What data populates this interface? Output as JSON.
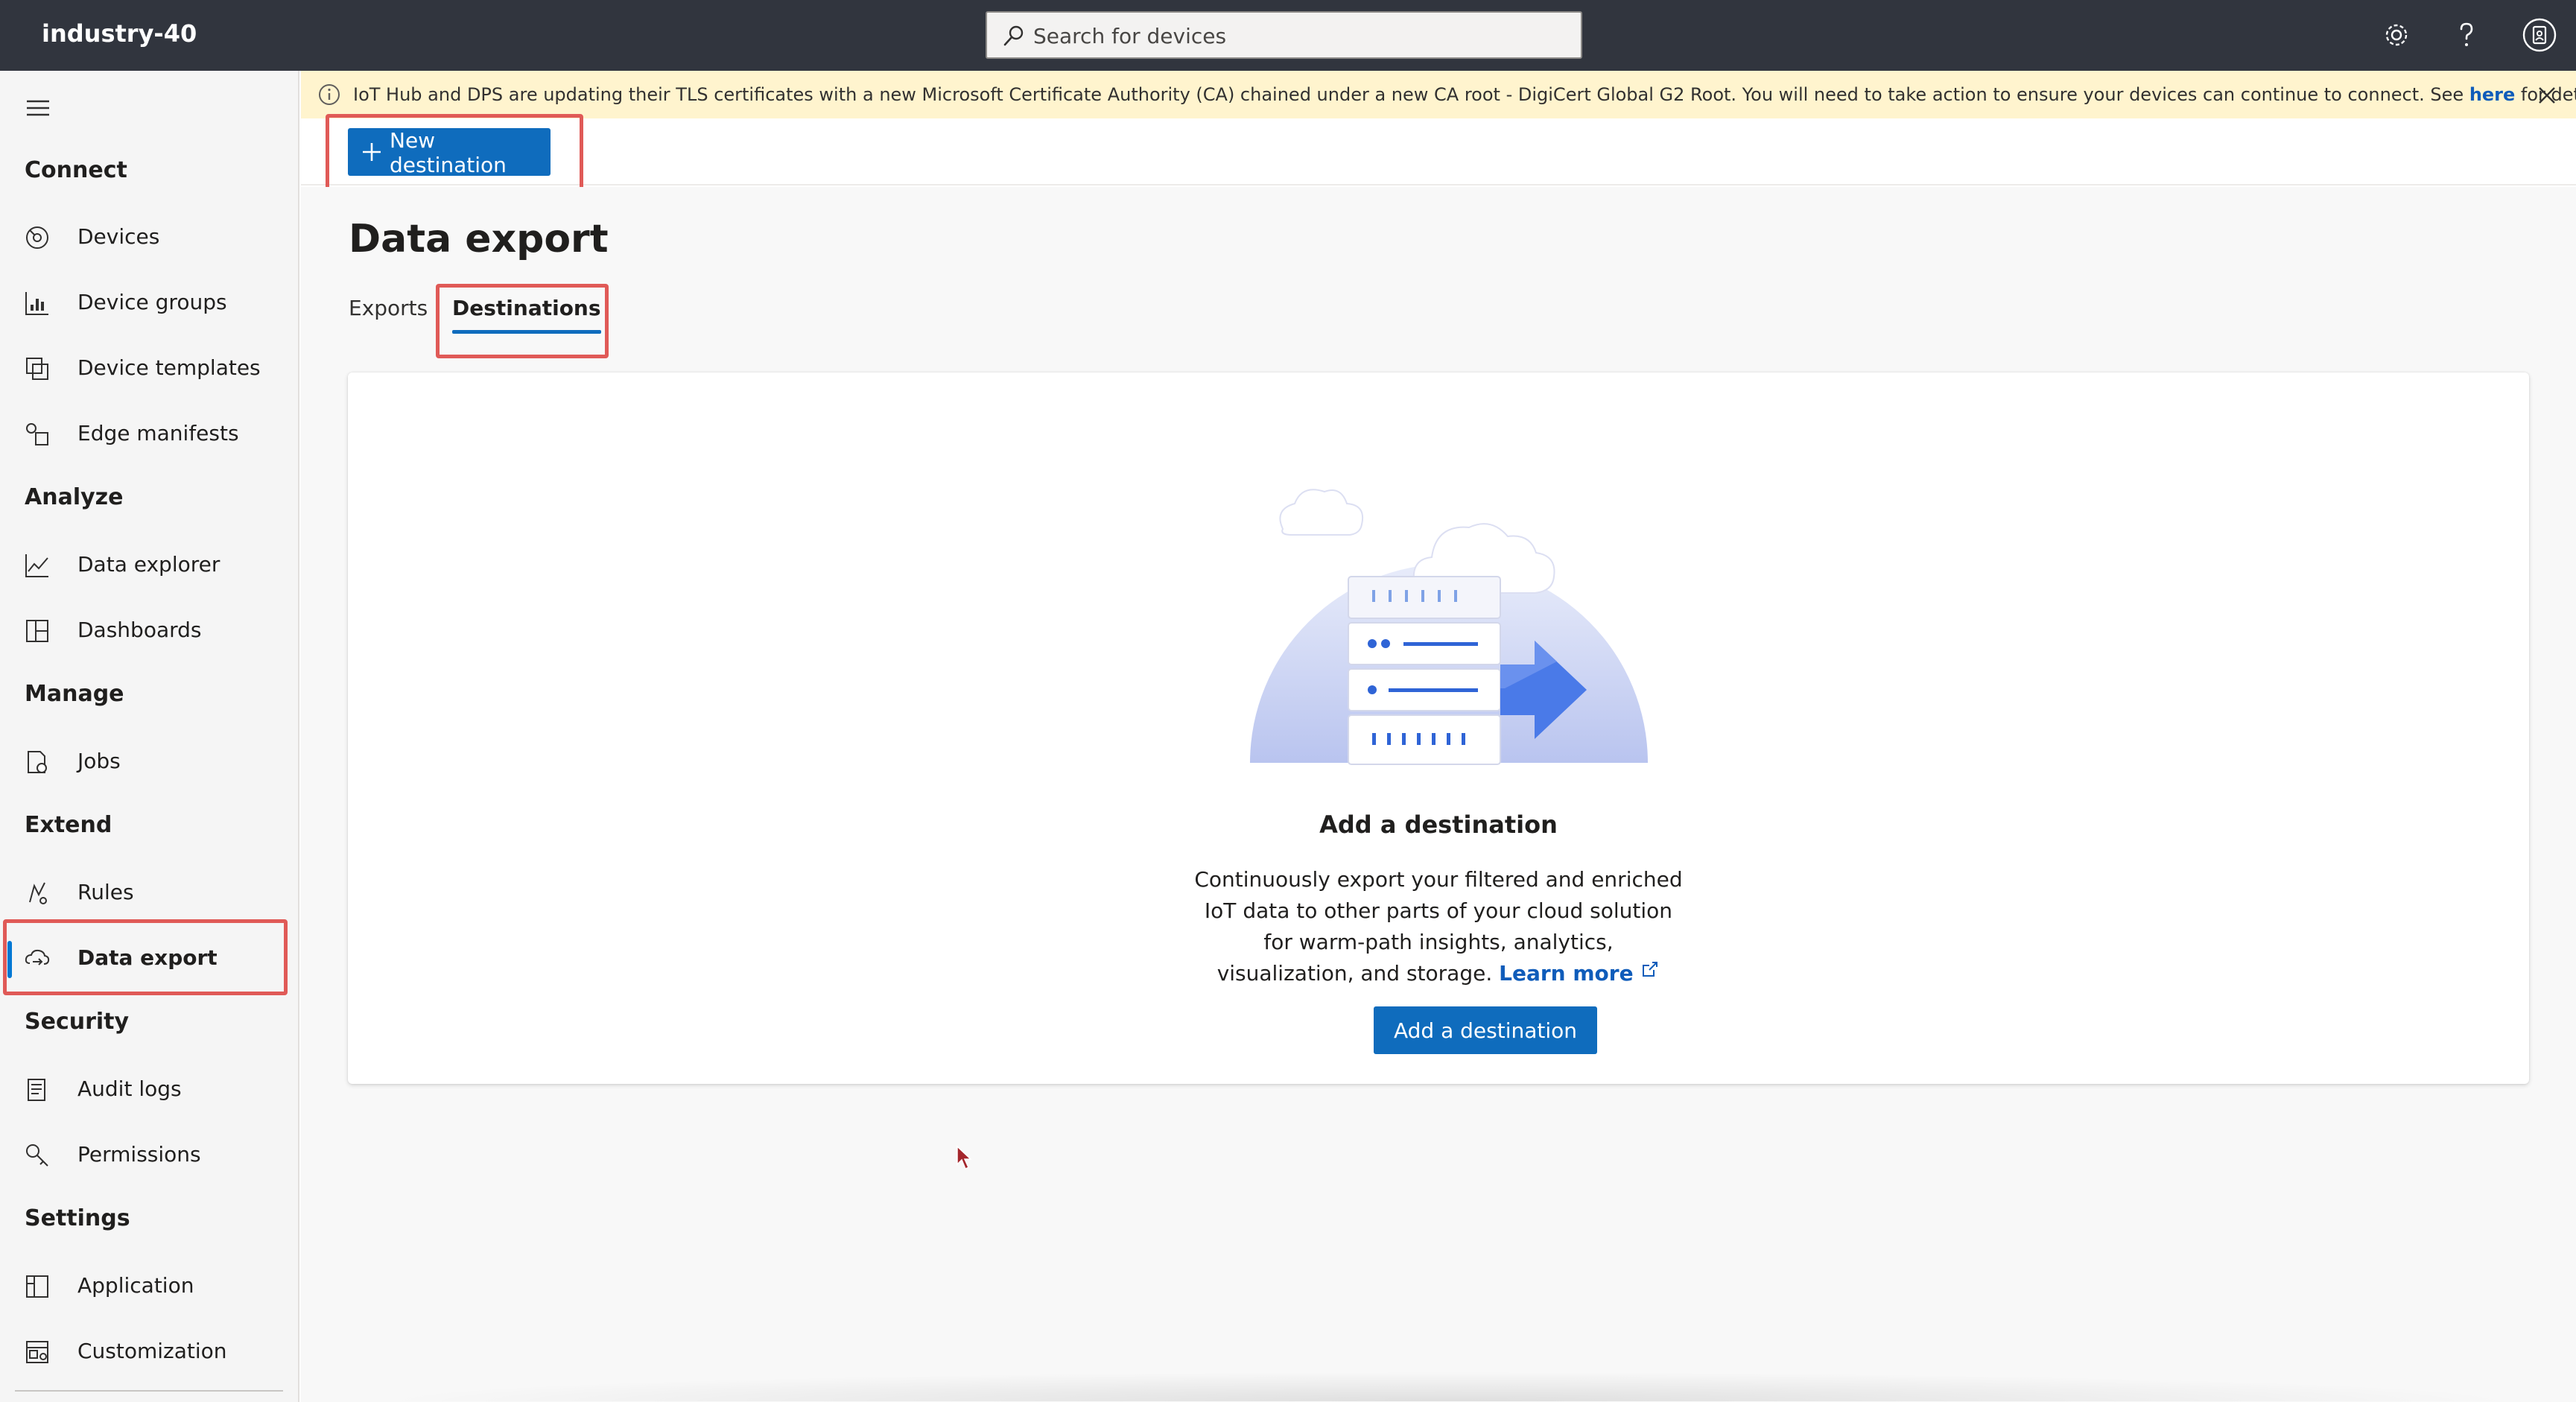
{
  "app": {
    "name": "industry-40"
  },
  "search": {
    "placeholder": "Search for devices"
  },
  "topbar": {
    "icons": [
      "gear-icon",
      "help-icon",
      "account-icon"
    ]
  },
  "sidebar": {
    "sections": [
      {
        "label": "Connect"
      },
      {
        "label": "Analyze"
      },
      {
        "label": "Manage"
      },
      {
        "label": "Extend"
      },
      {
        "label": "Security"
      },
      {
        "label": "Settings"
      }
    ],
    "items": [
      {
        "label": "Devices",
        "icon": "devices-icon"
      },
      {
        "label": "Device groups",
        "icon": "device-groups-icon"
      },
      {
        "label": "Device templates",
        "icon": "device-templates-icon"
      },
      {
        "label": "Edge manifests",
        "icon": "edge-manifests-icon"
      },
      {
        "label": "Data explorer",
        "icon": "data-explorer-icon"
      },
      {
        "label": "Dashboards",
        "icon": "dashboards-icon"
      },
      {
        "label": "Jobs",
        "icon": "jobs-icon"
      },
      {
        "label": "Rules",
        "icon": "rules-icon"
      },
      {
        "label": "Data export",
        "icon": "data-export-icon",
        "active": true
      },
      {
        "label": "Audit logs",
        "icon": "audit-logs-icon"
      },
      {
        "label": "Permissions",
        "icon": "permissions-icon"
      },
      {
        "label": "Application",
        "icon": "application-icon"
      },
      {
        "label": "Customization",
        "icon": "customization-icon"
      }
    ]
  },
  "banner": {
    "text": "IoT Hub and DPS are updating their TLS certificates with a new Microsoft Certificate Authority (CA) chained under a new CA root - DigiCert Global G2 Root. You will need to take action to ensure your devices can continue to connect. See ",
    "link": "here",
    "suffix": " for details."
  },
  "toolbar": {
    "new_destination_label": "New destination"
  },
  "page": {
    "title": "Data export",
    "tabs": [
      {
        "label": "Exports",
        "selected": false
      },
      {
        "label": "Destinations",
        "selected": true
      }
    ]
  },
  "empty_state": {
    "heading": "Add a destination",
    "description": "Continuously export your filtered and enriched IoT data to other parts of your cloud solution for warm-path insights, analytics, visualization, and storage. ",
    "learn_more": "Learn more",
    "button_label": "Add a destination"
  },
  "colors": {
    "topbar": "#31353e",
    "accent": "#0f6cbd",
    "banner": "#fff4ce",
    "highlight": "#e05a57"
  }
}
